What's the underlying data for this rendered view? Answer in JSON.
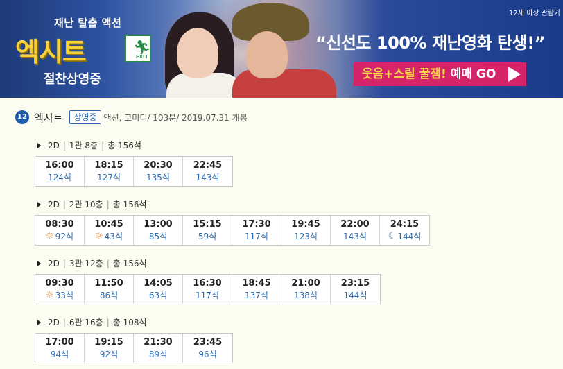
{
  "banner": {
    "tagline": "재난 탈출 액션",
    "logo_text": "엑시트",
    "exit_sign_text": "EXIT",
    "now_showing": "절찬상영중",
    "age_note": "12세 이상 관람가",
    "slogan": "“신선도 100% 재난영화 탄생!”",
    "cta_highlight": "웃음+스릴 꿀잼!",
    "cta_action": "예매 GO"
  },
  "movie": {
    "age_rating": "12",
    "title": "엑시트",
    "status": "상영중",
    "meta": "액션, 코미디/ 103분/ 2019.07.31 개봉"
  },
  "screens": [
    {
      "format": "2D",
      "hall": "1관 8층",
      "total": "총 156석",
      "slots": [
        {
          "time": "16:00",
          "seats": "124석",
          "icon": ""
        },
        {
          "time": "18:15",
          "seats": "127석",
          "icon": ""
        },
        {
          "time": "20:30",
          "seats": "135석",
          "icon": ""
        },
        {
          "time": "22:45",
          "seats": "143석",
          "icon": ""
        }
      ]
    },
    {
      "format": "2D",
      "hall": "2관 10층",
      "total": "총 156석",
      "slots": [
        {
          "time": "08:30",
          "seats": "92석",
          "icon": "sun"
        },
        {
          "time": "10:45",
          "seats": "43석",
          "icon": "sun"
        },
        {
          "time": "13:00",
          "seats": "85석",
          "icon": ""
        },
        {
          "time": "15:15",
          "seats": "59석",
          "icon": ""
        },
        {
          "time": "17:30",
          "seats": "117석",
          "icon": ""
        },
        {
          "time": "19:45",
          "seats": "123석",
          "icon": ""
        },
        {
          "time": "22:00",
          "seats": "143석",
          "icon": ""
        },
        {
          "time": "24:15",
          "seats": "144석",
          "icon": "moon"
        }
      ]
    },
    {
      "format": "2D",
      "hall": "3관 12층",
      "total": "총 156석",
      "slots": [
        {
          "time": "09:30",
          "seats": "33석",
          "icon": "sun"
        },
        {
          "time": "11:50",
          "seats": "86석",
          "icon": ""
        },
        {
          "time": "14:05",
          "seats": "63석",
          "icon": ""
        },
        {
          "time": "16:30",
          "seats": "117석",
          "icon": ""
        },
        {
          "time": "18:45",
          "seats": "137석",
          "icon": ""
        },
        {
          "time": "21:00",
          "seats": "138석",
          "icon": ""
        },
        {
          "time": "23:15",
          "seats": "144석",
          "icon": ""
        }
      ]
    },
    {
      "format": "2D",
      "hall": "6관 16층",
      "total": "총 108석",
      "slots": [
        {
          "time": "17:00",
          "seats": "94석",
          "icon": ""
        },
        {
          "time": "19:15",
          "seats": "92석",
          "icon": ""
        },
        {
          "time": "21:30",
          "seats": "89석",
          "icon": ""
        },
        {
          "time": "23:45",
          "seats": "96석",
          "icon": ""
        }
      ]
    }
  ],
  "colors": {
    "accent_blue": "#2a6ab4",
    "banner_blue": "#1e3a78",
    "cta_pink": "#d6246b",
    "logo_yellow": "#f7d23a"
  }
}
